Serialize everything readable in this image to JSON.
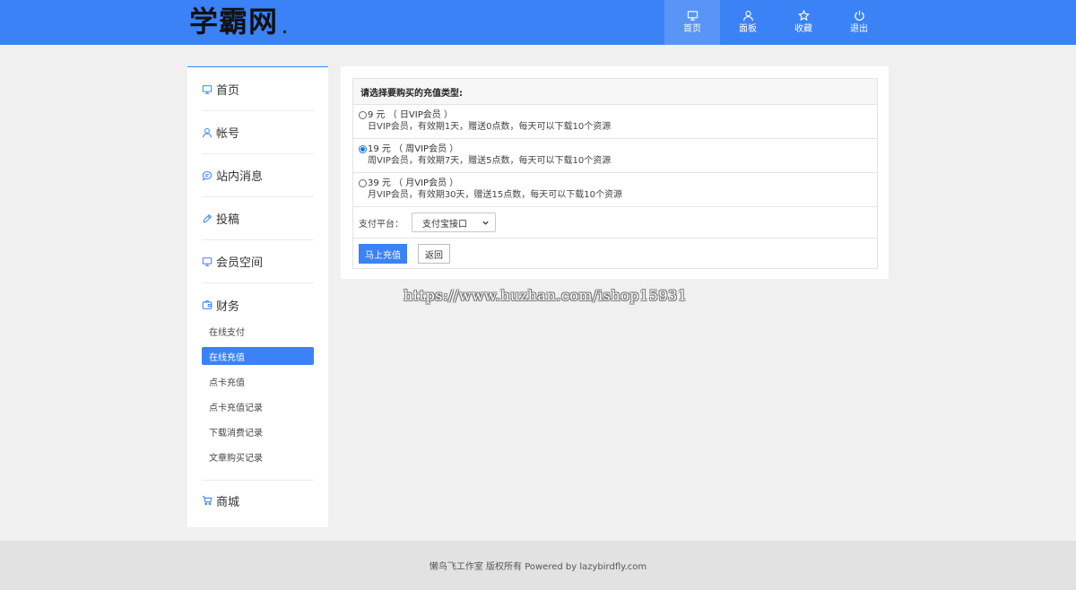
{
  "header": {
    "logo": "学霸网",
    "nav": [
      {
        "label": "首页",
        "icon": "monitor-icon",
        "active": true
      },
      {
        "label": "面板",
        "icon": "user-icon"
      },
      {
        "label": "收藏",
        "icon": "star-icon"
      },
      {
        "label": "退出",
        "icon": "power-icon"
      }
    ]
  },
  "sidebar": {
    "items": [
      {
        "label": "首页",
        "icon": "monitor-icon"
      },
      {
        "label": "帐号",
        "icon": "user-icon"
      },
      {
        "label": "站内消息",
        "icon": "message-icon"
      },
      {
        "label": "投稿",
        "icon": "pen-icon"
      },
      {
        "label": "会员空间",
        "icon": "monitor-icon"
      },
      {
        "label": "财务",
        "icon": "wallet-icon"
      },
      {
        "label": "商城",
        "icon": "cart-icon"
      }
    ],
    "finance_sub": [
      {
        "label": "在线支付"
      },
      {
        "label": "在线充值",
        "active": true
      },
      {
        "label": "点卡充值"
      },
      {
        "label": "点卡充值记录"
      },
      {
        "label": "下载消费记录"
      },
      {
        "label": "文章购买记录"
      }
    ]
  },
  "recharge": {
    "heading": "请选择要购买的充值类型:",
    "options": [
      {
        "title": "9 元 （ 日VIP会员 ）",
        "desc": "日VIP会员，有效期1天，赠送0点数，每天可以下载10个资源",
        "checked": false
      },
      {
        "title": "19 元 （ 周VIP会员 ）",
        "desc": "周VIP会员，有效期7天，赠送5点数，每天可以下载10个资源",
        "checked": true
      },
      {
        "title": "39 元 （ 月VIP会员 ）",
        "desc": "月VIP会员，有效期30天，赠送15点数，每天可以下载10个资源",
        "checked": false
      }
    ],
    "pay_label": "支付平台：",
    "pay_value": "支付宝接口",
    "submit": "马上充值",
    "back": "返回"
  },
  "watermark": "https://www.huzhan.com/ishop15931",
  "footer": "懒鸟飞工作室 版权所有 Powered by lazybirdfly.com",
  "colors": {
    "accent": "#3b82f6",
    "background": "#f0f0f0"
  }
}
